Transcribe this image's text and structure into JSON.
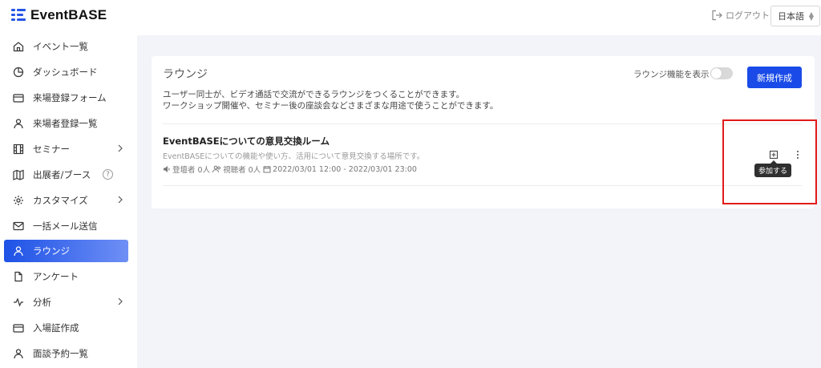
{
  "app": {
    "name": "EventBASE",
    "brand_color": "#2455e6"
  },
  "header": {
    "logout_label": "ログアウト",
    "language": "日本語"
  },
  "sidebar": {
    "items": [
      {
        "label": "イベント一覧",
        "icon": "home-icon"
      },
      {
        "label": "ダッシュボード",
        "icon": "pie-chart-icon"
      },
      {
        "label": "来場登録フォーム",
        "icon": "form-icon"
      },
      {
        "label": "来場者登録一覧",
        "icon": "user-icon"
      },
      {
        "label": "セミナー",
        "icon": "film-icon",
        "has_submenu": true
      },
      {
        "label": "出展者/ブース",
        "icon": "map-icon",
        "help": "?"
      },
      {
        "label": "カスタマイズ",
        "icon": "gear-icon",
        "has_submenu": true
      },
      {
        "label": "一括メール送信",
        "icon": "mail-icon"
      },
      {
        "label": "ラウンジ",
        "icon": "user-icon",
        "active": true
      },
      {
        "label": "アンケート",
        "icon": "document-icon"
      },
      {
        "label": "分析",
        "icon": "activity-icon",
        "has_submenu": true
      },
      {
        "label": "入場証作成",
        "icon": "card-icon"
      },
      {
        "label": "面談予約一覧",
        "icon": "user-icon"
      }
    ]
  },
  "lounge": {
    "title": "ラウンジ",
    "toggle_label": "ラウンジ機能を表示",
    "toggle_on": false,
    "new_button": "新規作成",
    "description_line1": "ユーザー同士が、ビデオ通話で交流ができるラウンジをつくることができます。",
    "description_line2": "ワークショップ開催や、セミナー後の座談会などさまざまな用途で使うことができます。",
    "rooms": [
      {
        "title": "EventBASEについての意見交換ルーム",
        "description": "EventBASEについての機能や使い方、活用について意見交換する場所です。",
        "speakers": "登壇者 0人",
        "viewers": "視聴者 0人",
        "period": "2022/03/01 12:00 - 2022/03/01 23:00",
        "join_tooltip": "参加する"
      }
    ]
  },
  "colors": {
    "accent": "#1a4be8",
    "highlight": "#e21a1a"
  }
}
